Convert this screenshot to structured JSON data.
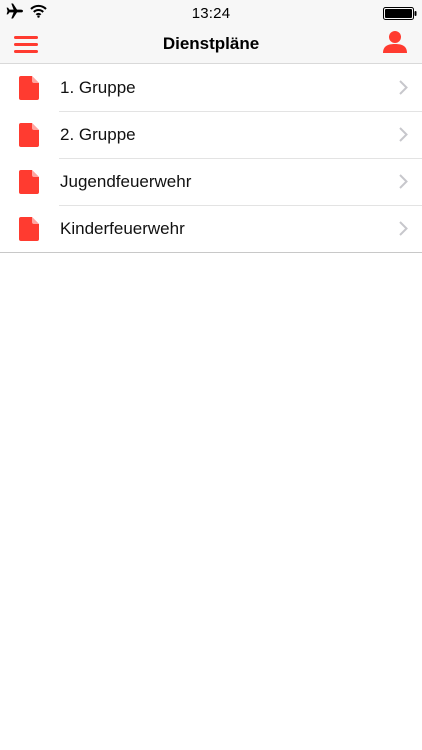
{
  "status_bar": {
    "time": "13:24",
    "icons": [
      "airplane-icon",
      "wifi-icon",
      "battery-icon"
    ]
  },
  "nav": {
    "title": "Dienstpläne",
    "left_icon": "menu-icon",
    "right_icon": "person-icon"
  },
  "list": {
    "items": [
      {
        "label": "1. Gruppe",
        "icon": "document-icon"
      },
      {
        "label": "2. Gruppe",
        "icon": "document-icon"
      },
      {
        "label": "Jugendfeuerwehr",
        "icon": "document-icon"
      },
      {
        "label": "Kinderfeuerwehr",
        "icon": "document-icon"
      }
    ]
  },
  "colors": {
    "accent": "#ff3b30",
    "bar_background": "#f7f7f7",
    "chevron": "#c7c7cc",
    "separator": "#e3e3e3"
  }
}
